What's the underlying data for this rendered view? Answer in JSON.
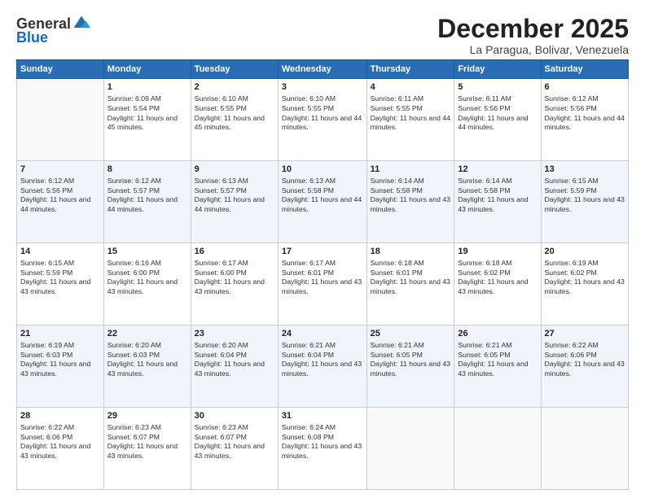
{
  "logo": {
    "general": "General",
    "blue": "Blue"
  },
  "title": "December 2025",
  "subtitle": "La Paragua, Bolivar, Venezuela",
  "days_of_week": [
    "Sunday",
    "Monday",
    "Tuesday",
    "Wednesday",
    "Thursday",
    "Friday",
    "Saturday"
  ],
  "weeks": [
    [
      {
        "day": "",
        "empty": true
      },
      {
        "day": "1",
        "sunrise": "6:09 AM",
        "sunset": "5:54 PM",
        "daylight": "11 hours and 45 minutes."
      },
      {
        "day": "2",
        "sunrise": "6:10 AM",
        "sunset": "5:55 PM",
        "daylight": "11 hours and 45 minutes."
      },
      {
        "day": "3",
        "sunrise": "6:10 AM",
        "sunset": "5:55 PM",
        "daylight": "11 hours and 44 minutes."
      },
      {
        "day": "4",
        "sunrise": "6:11 AM",
        "sunset": "5:55 PM",
        "daylight": "11 hours and 44 minutes."
      },
      {
        "day": "5",
        "sunrise": "6:11 AM",
        "sunset": "5:56 PM",
        "daylight": "11 hours and 44 minutes."
      },
      {
        "day": "6",
        "sunrise": "6:12 AM",
        "sunset": "5:56 PM",
        "daylight": "11 hours and 44 minutes."
      }
    ],
    [
      {
        "day": "7",
        "sunrise": "6:12 AM",
        "sunset": "5:56 PM",
        "daylight": "11 hours and 44 minutes."
      },
      {
        "day": "8",
        "sunrise": "6:12 AM",
        "sunset": "5:57 PM",
        "daylight": "11 hours and 44 minutes."
      },
      {
        "day": "9",
        "sunrise": "6:13 AM",
        "sunset": "5:57 PM",
        "daylight": "11 hours and 44 minutes."
      },
      {
        "day": "10",
        "sunrise": "6:13 AM",
        "sunset": "5:58 PM",
        "daylight": "11 hours and 44 minutes."
      },
      {
        "day": "11",
        "sunrise": "6:14 AM",
        "sunset": "5:58 PM",
        "daylight": "11 hours and 43 minutes."
      },
      {
        "day": "12",
        "sunrise": "6:14 AM",
        "sunset": "5:58 PM",
        "daylight": "11 hours and 43 minutes."
      },
      {
        "day": "13",
        "sunrise": "6:15 AM",
        "sunset": "5:59 PM",
        "daylight": "11 hours and 43 minutes."
      }
    ],
    [
      {
        "day": "14",
        "sunrise": "6:15 AM",
        "sunset": "5:59 PM",
        "daylight": "11 hours and 43 minutes."
      },
      {
        "day": "15",
        "sunrise": "6:16 AM",
        "sunset": "6:00 PM",
        "daylight": "11 hours and 43 minutes."
      },
      {
        "day": "16",
        "sunrise": "6:17 AM",
        "sunset": "6:00 PM",
        "daylight": "11 hours and 43 minutes."
      },
      {
        "day": "17",
        "sunrise": "6:17 AM",
        "sunset": "6:01 PM",
        "daylight": "11 hours and 43 minutes."
      },
      {
        "day": "18",
        "sunrise": "6:18 AM",
        "sunset": "6:01 PM",
        "daylight": "11 hours and 43 minutes."
      },
      {
        "day": "19",
        "sunrise": "6:18 AM",
        "sunset": "6:02 PM",
        "daylight": "11 hours and 43 minutes."
      },
      {
        "day": "20",
        "sunrise": "6:19 AM",
        "sunset": "6:02 PM",
        "daylight": "11 hours and 43 minutes."
      }
    ],
    [
      {
        "day": "21",
        "sunrise": "6:19 AM",
        "sunset": "6:03 PM",
        "daylight": "11 hours and 43 minutes."
      },
      {
        "day": "22",
        "sunrise": "6:20 AM",
        "sunset": "6:03 PM",
        "daylight": "11 hours and 43 minutes."
      },
      {
        "day": "23",
        "sunrise": "6:20 AM",
        "sunset": "6:04 PM",
        "daylight": "11 hours and 43 minutes."
      },
      {
        "day": "24",
        "sunrise": "6:21 AM",
        "sunset": "6:04 PM",
        "daylight": "11 hours and 43 minutes."
      },
      {
        "day": "25",
        "sunrise": "6:21 AM",
        "sunset": "6:05 PM",
        "daylight": "11 hours and 43 minutes."
      },
      {
        "day": "26",
        "sunrise": "6:21 AM",
        "sunset": "6:05 PM",
        "daylight": "11 hours and 43 minutes."
      },
      {
        "day": "27",
        "sunrise": "6:22 AM",
        "sunset": "6:06 PM",
        "daylight": "11 hours and 43 minutes."
      }
    ],
    [
      {
        "day": "28",
        "sunrise": "6:22 AM",
        "sunset": "6:06 PM",
        "daylight": "11 hours and 43 minutes."
      },
      {
        "day": "29",
        "sunrise": "6:23 AM",
        "sunset": "6:07 PM",
        "daylight": "11 hours and 43 minutes."
      },
      {
        "day": "30",
        "sunrise": "6:23 AM",
        "sunset": "6:07 PM",
        "daylight": "11 hours and 43 minutes."
      },
      {
        "day": "31",
        "sunrise": "6:24 AM",
        "sunset": "6:08 PM",
        "daylight": "11 hours and 43 minutes."
      },
      {
        "day": "",
        "empty": true
      },
      {
        "day": "",
        "empty": true
      },
      {
        "day": "",
        "empty": true
      }
    ]
  ]
}
